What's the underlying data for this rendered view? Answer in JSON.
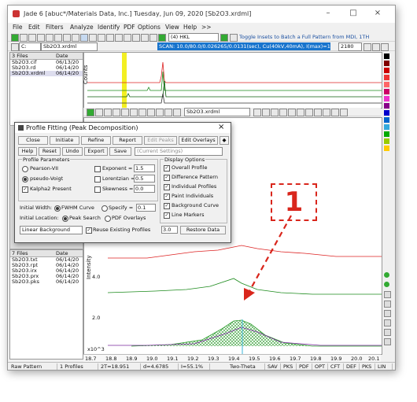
{
  "window": {
    "title": "Jade 6 [abuc*/Materials Data, Inc.] Tuesday, Jun 09, 2020 [Sb2O3.xrdml]"
  },
  "menu": [
    "File",
    "Edit",
    "Filters",
    "Analyze",
    "Identify",
    "PDF",
    "Options",
    "View",
    "Help",
    ">>"
  ],
  "toolbar": {
    "dropdown": "(4) HKL",
    "hint": "Toggle Insets to Batch a Full Pattern from MDI, 1TH"
  },
  "file_selector": "Sb2O3.xrdml",
  "scan_info": "SCAN: 10.0/80.0/0.026265/0.0131(sec), Cu(40kV,40mA), I(max)=1201, 06/24/20 10:31",
  "scan_value": "2180",
  "upper_files": {
    "header": [
      "3 Files",
      "Date"
    ],
    "rows": [
      [
        "Sb2O3.cif",
        "06/13/20"
      ],
      [
        "Sb2O3.rd",
        "06/14/20"
      ],
      [
        "Sb2O3.xrdml",
        "06/14/20"
      ]
    ]
  },
  "lower_files": {
    "header": [
      "7 Files",
      "Date"
    ],
    "rows": [
      [
        "Sb2O3.txt",
        "06/14/20"
      ],
      [
        "Sb2O3.rpt",
        "06/14/20"
      ],
      [
        "Sb2O3.irx",
        "06/14/20"
      ],
      [
        "Sb2O3.prx",
        "06/14/20"
      ],
      [
        "Sb2O3.pks",
        "06/14/20"
      ]
    ]
  },
  "overlay_dropdown": "Sb2O3.xrdml",
  "plot": {
    "upper_ylabel": "Counts",
    "lower_ylabel": "Intensity",
    "y_ticks": [
      "4.0",
      "2.0"
    ],
    "y_scale": "x10^3",
    "x_ticks": [
      "18.7",
      "18.8",
      "18.9",
      "19.0",
      "19.1",
      "19.2",
      "19.3",
      "19.4",
      "19.5",
      "19.6",
      "19.7",
      "19.8",
      "19.9",
      "20.0",
      "20.1"
    ]
  },
  "dialog": {
    "title": "Profile Fitting (Peak Decomposition)",
    "row1": [
      "Close",
      "Initiate",
      "Refine",
      "Report",
      "Edit Peaks",
      "Edit Overlays"
    ],
    "row2": [
      "Help",
      "Reset",
      "Undo",
      "Export",
      "Save"
    ],
    "settings": "(Current Settings)",
    "profile_group": "Profile Parameters",
    "display_group": "Display Options",
    "profiles": [
      {
        "label": "Pearson-VII",
        "param": "Exponent =",
        "value": "1.5"
      },
      {
        "label": "pseudo-Voigt",
        "param": "Lorentzian =",
        "value": "0.5"
      },
      {
        "label": "Kalpha2 Present",
        "param": "Skewness =",
        "value": "0.0"
      }
    ],
    "initial_width_label": "Initial Width:",
    "fwhm_label": "FWHM Curve",
    "specify_label": "Specify =",
    "specify_value": "0.1",
    "initial_location_label": "Initial Location:",
    "peak_search_label": "Peak Search",
    "pdf_overlays_label": "PDF Overlays",
    "background": "Linear Background",
    "reuse_label": "Reuse Existing Profiles",
    "bottom_value": "3.0",
    "restore_label": "Restore Data",
    "display_options": [
      "Overall Profile",
      "Difference Pattern",
      "Individual Profiles",
      "Paint Individuals",
      "Background Curve",
      "Line Markers"
    ]
  },
  "annotation": {
    "label": "1",
    "color": "#d9261c"
  },
  "status": [
    "Raw Pattern",
    "1 Profiles",
    "2T=18.951",
    "d=4.6785",
    "I=55.1%",
    "Two-Theta",
    "SAV",
    "PKS",
    "PDF",
    "OPT",
    "CFT",
    "DEF",
    "PKS",
    "LIN"
  ]
}
